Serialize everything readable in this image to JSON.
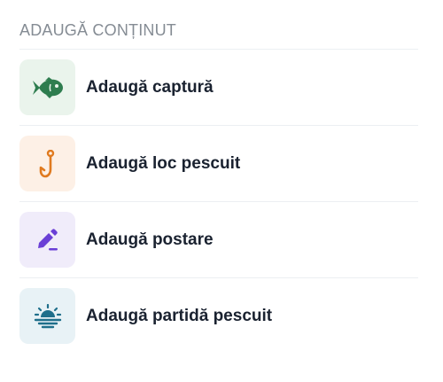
{
  "section": {
    "title": "ADAUGĂ CONȚINUT"
  },
  "items": [
    {
      "label": "Adaugă captură",
      "icon": "fish-icon",
      "icon_color": "#2e7d4f",
      "bg_color": "#eaf4ec"
    },
    {
      "label": "Adaugă loc pescuit",
      "icon": "fishing-hook-icon",
      "icon_color": "#e07a1f",
      "bg_color": "#fdf0e6"
    },
    {
      "label": "Adaugă postare",
      "icon": "pencil-icon",
      "icon_color": "#6a3fd6",
      "bg_color": "#f0ecfa"
    },
    {
      "label": "Adaugă partidă pescuit",
      "icon": "sunrise-icon",
      "icon_color": "#1f6f8b",
      "bg_color": "#e8f2f6"
    }
  ]
}
